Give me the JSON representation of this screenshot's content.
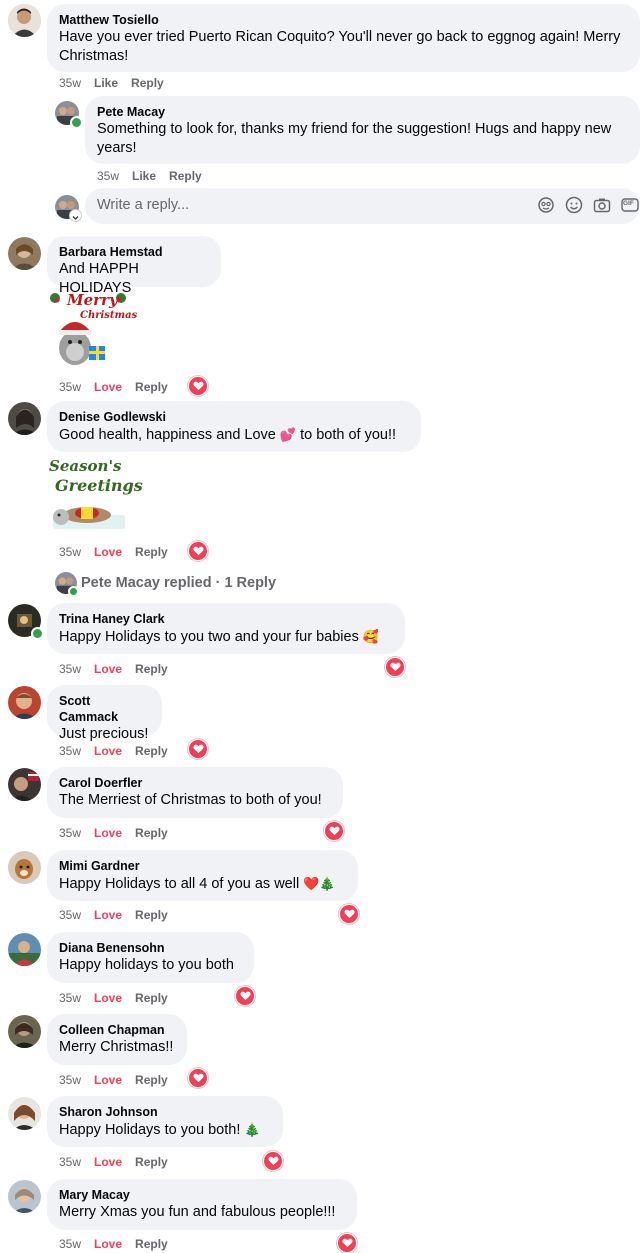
{
  "thread": {
    "comment": {
      "author": "Matthew Tosiello",
      "text": "Have you ever tried Puerto Rican Coquito? You'll never go back to eggnog again! Merry Christmas!",
      "time": "35w",
      "like": "Like",
      "reply": "Reply"
    },
    "reply": {
      "author": "Pete Macay",
      "text": "Something to look for, thanks my friend for the suggestion! Hugs and happy new years!",
      "time": "35w",
      "like": "Like",
      "reply": "Reply"
    },
    "write_reply": {
      "placeholder": "Write a reply...",
      "gif_label": "GIF"
    }
  },
  "comments": [
    {
      "author": "Barbara Hemstad",
      "text": "And HAPPH HOLIDAYS",
      "time": "35w",
      "reaction": "Love",
      "reply": "Reply",
      "sticker": {
        "line1": "Merry",
        "line2": "Christmas"
      }
    },
    {
      "author": "Denise Godlewski",
      "text": "Good health, happiness and Love",
      "text_after": "to both of you!!",
      "emoji": "💕",
      "time": "35w",
      "reaction": "Love",
      "reply": "Reply",
      "sticker": {
        "line1": "Season's",
        "line2": "Greetings"
      }
    },
    {
      "author": "Trina Haney Clark",
      "text": "Happy Holidays to you two and your fur babies",
      "emoji": "🥰",
      "time": "35w",
      "reaction": "Love",
      "reply": "Reply"
    },
    {
      "author": "Scott Cammack",
      "text": "Just precious!",
      "time": "35w",
      "reaction": "Love",
      "reply": "Reply"
    },
    {
      "author": "Carol Doerfler",
      "text": "The Merriest of Christmas to both of you!",
      "time": "35w",
      "reaction": "Love",
      "reply": "Reply"
    },
    {
      "author": "Mimi Gardner",
      "text": "Happy Holidays to all 4 of you as well",
      "emoji": "❤️🎄",
      "time": "35w",
      "reaction": "Love",
      "reply": "Reply"
    },
    {
      "author": "Diana Benensohn",
      "text": "Happy holidays to you both",
      "time": "35w",
      "reaction": "Love",
      "reply": "Reply"
    },
    {
      "author": "Colleen Chapman",
      "text": "Merry Christmas!!",
      "time": "35w",
      "reaction": "Love",
      "reply": "Reply"
    },
    {
      "author": "Sharon Johnson",
      "text": "Happy Holidays to you both!",
      "emoji": "🎄",
      "time": "35w",
      "reaction": "Love",
      "reply": "Reply"
    },
    {
      "author": "Mary Macay",
      "text": "Merry Xmas you fun and fabulous people!!!",
      "time": "35w",
      "reaction": "Love",
      "reply": "Reply"
    }
  ],
  "replied_summary": {
    "text": "Pete Macay replied · 1 Reply"
  },
  "colors": {
    "love": "#f33e58",
    "bubble": "#f0f2f5",
    "meta": "#65676b",
    "online": "#31a24c"
  }
}
